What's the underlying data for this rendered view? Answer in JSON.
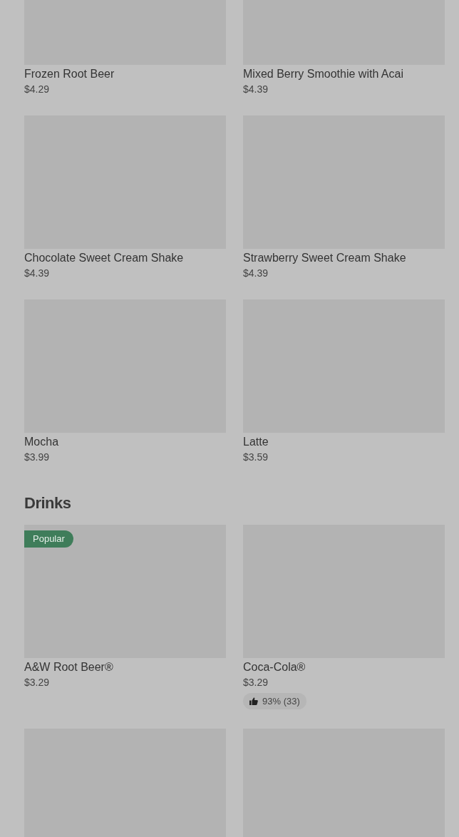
{
  "sections": [
    {
      "items": [
        {
          "kind": "dish",
          "name": "Frozen Root Beer",
          "price": "$4.29"
        },
        {
          "kind": "dish",
          "name": "Mixed Berry Smoothie with Acai",
          "price": "$4.39"
        },
        {
          "kind": "dish",
          "name": "Chocolate Sweet Cream Shake",
          "price": "$4.39"
        },
        {
          "kind": "dish",
          "name": "Strawberry Sweet Cream Shake",
          "price": "$4.39"
        },
        {
          "kind": "dish",
          "name": "Mocha",
          "price": "$3.99"
        },
        {
          "kind": "dish",
          "name": "Latte",
          "price": "$3.59"
        }
      ]
    },
    {
      "title": "Drinks",
      "items": [
        {
          "kind": "dish",
          "name": "A&W Root Beer®",
          "price": "$3.29",
          "badge": "Popular"
        },
        {
          "kind": "dish",
          "name": "Coca-Cola®",
          "price": "$3.29",
          "rating": "93% (33)"
        },
        {
          "kind": "picture"
        },
        {
          "kind": "picture"
        }
      ]
    }
  ]
}
